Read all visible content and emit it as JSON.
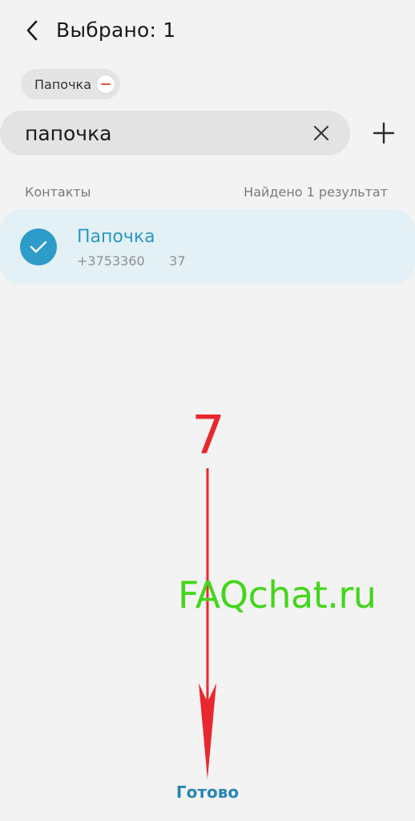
{
  "header": {
    "title": "Выбрано: 1"
  },
  "selected_chip": {
    "label": "Папочка"
  },
  "search": {
    "value": "папочка"
  },
  "section": {
    "label": "Контакты",
    "results": "Найдено 1 результат"
  },
  "contact": {
    "name": "Папочка",
    "phone": "+3753360      37",
    "selected": true
  },
  "annotations": {
    "step": "7",
    "watermark": "FAQchat.ru"
  },
  "footer": {
    "done_label": "Готово"
  },
  "colors": {
    "accent": "#2e9cc9",
    "card_bg": "#e3f1f6",
    "annotation_red": "#e8282e",
    "watermark_green": "#43d61a"
  },
  "icons": {
    "back": "chevron-left-icon",
    "remove": "minus-circle-icon",
    "clear": "close-icon",
    "add": "plus-icon",
    "check": "check-icon"
  }
}
